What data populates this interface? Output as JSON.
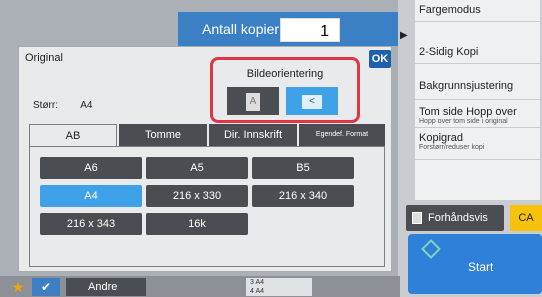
{
  "header": {
    "copies_label": "Antall kopier",
    "copies_value": "1"
  },
  "right_panel": {
    "items": [
      {
        "main": "Fargemodus",
        "sub": ""
      },
      {
        "main": "2-Sidig Kopi",
        "sub": ""
      },
      {
        "main": "Bakgrunnsjustering",
        "sub": ""
      },
      {
        "main": "Tom side Hopp over",
        "sub": "Hopp over tom side i original"
      },
      {
        "main": "Kopigrad",
        "sub": "Forstørr/reduser kopi"
      }
    ],
    "preview_label": "Forhåndsvis",
    "ca_label": "CA",
    "start_label": "Start"
  },
  "dialog": {
    "title": "Original",
    "ok_label": "OK",
    "size_label": "Størr:",
    "size_value": "A4",
    "orientation": {
      "label": "Bildeorientering",
      "portrait_glyph": "A",
      "landscape_glyph": "<"
    },
    "tabs": [
      "AB",
      "Tomme",
      "Dir. Innskrift",
      "Egendef. Format"
    ],
    "sizes": [
      {
        "label": "A6",
        "selected": false
      },
      {
        "label": "A5",
        "selected": false
      },
      {
        "label": "B5",
        "selected": false
      },
      {
        "label": "A4",
        "selected": true
      },
      {
        "label": "216 x 330",
        "selected": false
      },
      {
        "label": "216 x 340",
        "selected": false
      },
      {
        "label": "216 x 343",
        "selected": false
      },
      {
        "label": "16k",
        "selected": false
      }
    ]
  },
  "bottom_bar": {
    "andre_label": "Andre",
    "tray_rows": [
      {
        "num": "3",
        "size": "A4"
      },
      {
        "num": "4",
        "size": "A4"
      }
    ]
  },
  "colors": {
    "accent": "#3b7fc4",
    "highlight": "#e33446",
    "selected": "#3fa1e7",
    "ca": "#f6c20c"
  }
}
